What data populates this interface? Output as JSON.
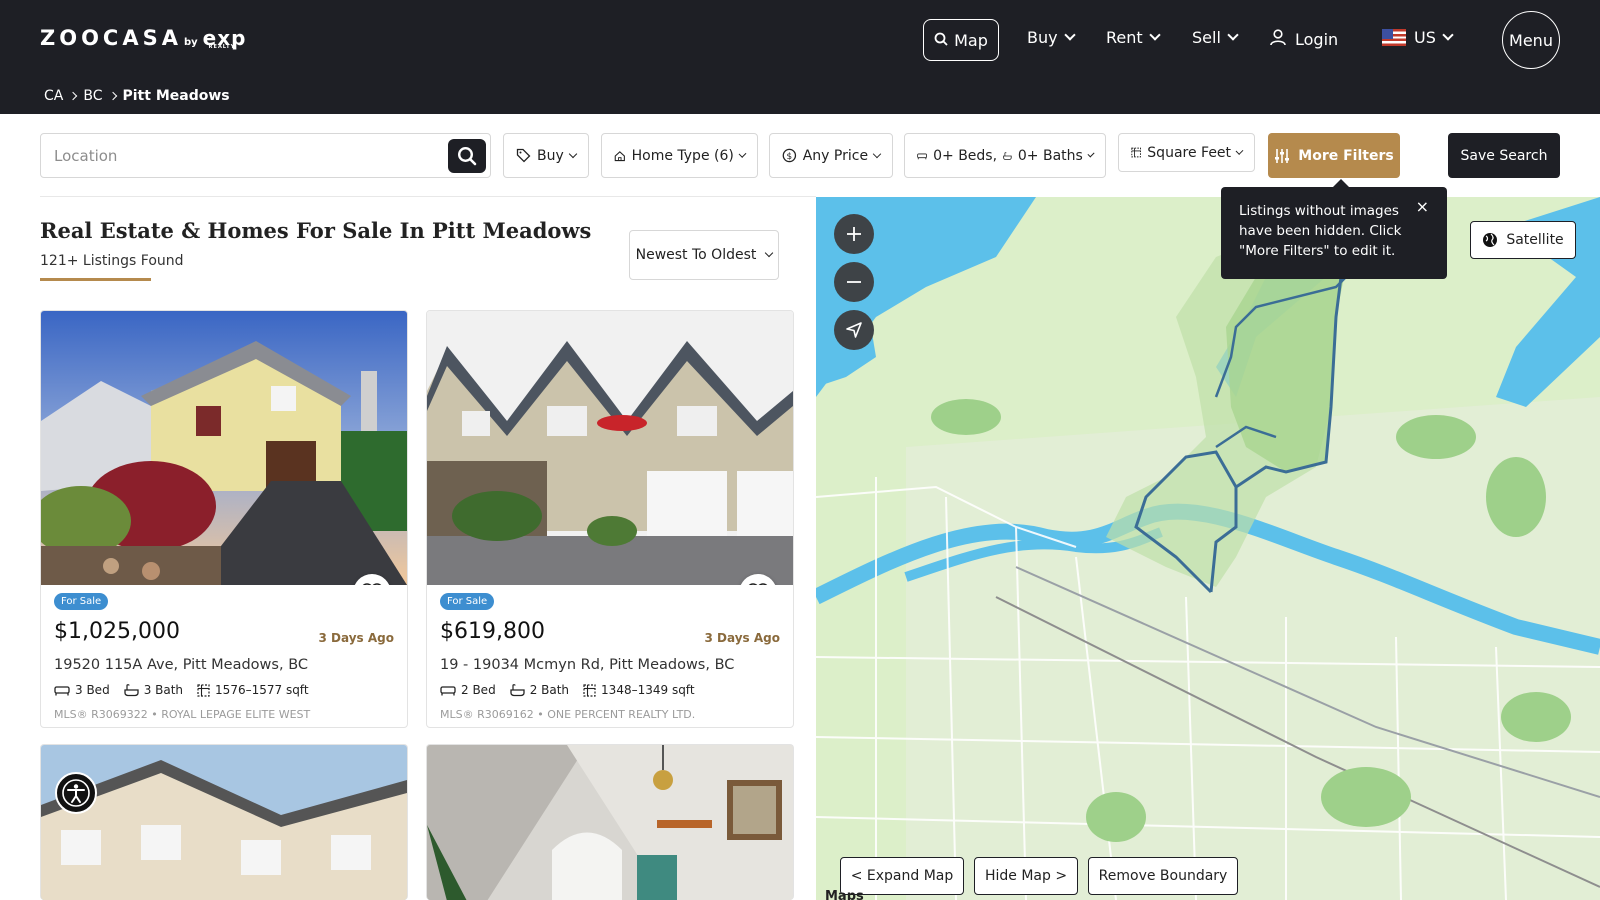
{
  "header": {
    "logo_word": "ZOOCASA",
    "logo_by": "by",
    "logo_partner": "exp",
    "logo_partner_sub": "REALTY",
    "nav": {
      "map_label": "Map",
      "buy_label": "Buy",
      "rent_label": "Rent",
      "sell_label": "Sell",
      "login_label": "Login",
      "country_label": "US",
      "menu_label": "Menu"
    },
    "breadcrumb": [
      "CA",
      "BC",
      "Pitt Meadows"
    ]
  },
  "filters": {
    "location_placeholder": "Location",
    "buy_label": "Buy",
    "home_type_label": "Home Type (6)",
    "price_label": "Any Price",
    "beds_label": "0+ Beds,",
    "baths_label": "0+ Baths",
    "sqft_label": "Square Feet",
    "more_filters_label": "More Filters",
    "save_search_label": "Save Search"
  },
  "tooltip": {
    "text": "Listings without images have been hidden. Click \"More Filters\" to edit it.",
    "close": "×"
  },
  "results": {
    "title": "Real Estate & Homes For Sale In Pitt Meadows",
    "count": "121+ Listings Found",
    "sort_label": "Newest To Oldest"
  },
  "listings": [
    {
      "status": "For Sale",
      "price": "$1,025,000",
      "ago": "3 Days Ago",
      "address": "19520 115A Ave, Pitt Meadows, BC",
      "beds": "3 Bed",
      "baths": "3 Bath",
      "sqft": "1576–1577 sqft",
      "mls": "MLS® R3069322 • ROYAL LEPAGE ELITE WEST"
    },
    {
      "status": "For Sale",
      "price": "$619,800",
      "ago": "3 Days Ago",
      "address": "19 - 19034 Mcmyn Rd, Pitt Meadows, BC",
      "beds": "2 Bed",
      "baths": "2 Bath",
      "sqft": "1348–1349 sqft",
      "mls": "MLS® R3069162 • ONE PERCENT REALTY LTD."
    }
  ],
  "map": {
    "satellite_label": "Satellite",
    "expand_label": "< Expand Map",
    "hide_label": "Hide Map >",
    "remove_boundary_label": "Remove Boundary",
    "attribution": "Maps"
  },
  "colors": {
    "header_bg": "#1e1f25",
    "accent_gold": "#b58a4d",
    "badge_blue": "#3d8ed0",
    "water": "#4fb8e6",
    "land": "#d9edc7",
    "boundary": "#3b6d96"
  }
}
